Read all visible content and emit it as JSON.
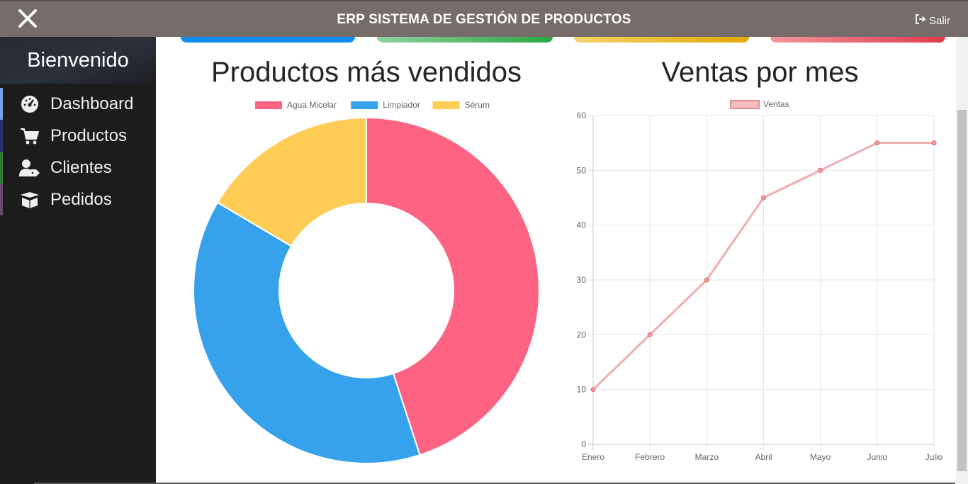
{
  "header": {
    "title": "ERP SISTEMA DE GESTIÓN DE PRODUCTOS",
    "logout_label": "Salir"
  },
  "sidebar": {
    "welcome": "Bienvenido",
    "items": [
      {
        "label": "Dashboard",
        "icon": "tachometer-icon",
        "accent": "#7b9fe0"
      },
      {
        "label": "Productos",
        "icon": "cart-icon",
        "accent": "#2a2f6e"
      },
      {
        "label": "Clientes",
        "icon": "user-tag-icon",
        "accent": "#2e7d32"
      },
      {
        "label": "Pedidos",
        "icon": "box-open-icon",
        "accent": "#6a4a6e"
      }
    ]
  },
  "cards": [
    "#0d8ff0",
    "#28a745",
    "#e0a800",
    "#e03a4a"
  ],
  "chart_data": [
    {
      "type": "doughnut",
      "title": "Productos más vendidos",
      "categories": [
        "Agua Micelar",
        "Limpiador",
        "Sérum"
      ],
      "values": [
        45,
        38.5,
        16.5
      ],
      "colors": [
        "#ff6384",
        "#36a2eb",
        "#ffcd56"
      ],
      "legend": "top"
    },
    {
      "type": "line",
      "title": "Ventas por mes",
      "categories": [
        "Enero",
        "Febrero",
        "Marzo",
        "Abril",
        "Mayo",
        "Junio",
        "Julio"
      ],
      "series": [
        {
          "name": "Ventas",
          "values": [
            10,
            20,
            30,
            45,
            50,
            55,
            55
          ]
        }
      ],
      "ylim": [
        0,
        60
      ],
      "yticks": [
        0,
        10,
        20,
        30,
        40,
        50,
        60
      ],
      "color": "#e98a8f",
      "grid": true,
      "legend": "top"
    }
  ]
}
